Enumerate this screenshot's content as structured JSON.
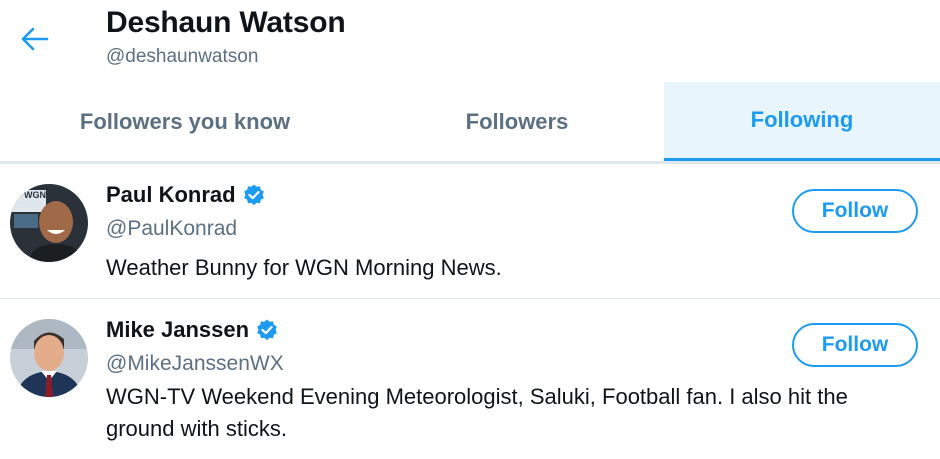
{
  "header": {
    "name": "Deshaun Watson",
    "handle": "@deshaunwatson",
    "back_icon": "arrow-left-icon"
  },
  "tabs": [
    {
      "label": "Followers you know",
      "active": false
    },
    {
      "label": "Followers",
      "active": false
    },
    {
      "label": "Following",
      "active": true
    }
  ],
  "users": [
    {
      "name": "Paul Konrad",
      "handle": "@PaulKonrad",
      "verified": true,
      "bio": "Weather Bunny for WGN Morning News.",
      "follow_label": "Follow",
      "avatar_text": "WGN"
    },
    {
      "name": "Mike Janssen",
      "handle": "@MikeJanssenWX",
      "verified": true,
      "bio": "WGN-TV Weekend Evening Meteorologist, Saluki, Football fan. I also hit the ground with sticks.",
      "follow_label": "Follow"
    }
  ],
  "colors": {
    "accent": "#1d9bf0",
    "active_tab_bg": "#e8f5fd",
    "secondary_text": "#5b7083",
    "divider": "#e1e8ed"
  }
}
